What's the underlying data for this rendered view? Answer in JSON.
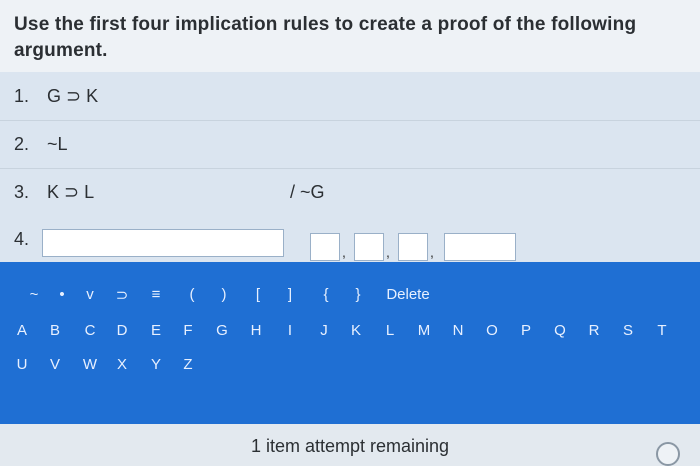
{
  "prompt": "Use the first four implication rules to create a proof of the following argument.",
  "premises": [
    {
      "num": "1.",
      "formula": "G ⊃ K"
    },
    {
      "num": "2.",
      "formula": "~L"
    },
    {
      "num": "3.",
      "formula": "K ⊃ L",
      "conclusion": "/ ~G"
    }
  ],
  "input_line": {
    "num": "4.",
    "formula_value": "",
    "justification_values": [
      "",
      "",
      "",
      ""
    ]
  },
  "keyboard": {
    "symbols": [
      "~",
      "•",
      "v",
      "⊃",
      "≡",
      "(",
      ")",
      "[",
      "]",
      "{",
      "}"
    ],
    "delete_label": "Delete",
    "letters_row1": [
      "A",
      "B",
      "C",
      "D",
      "E",
      "F",
      "G",
      "H",
      "I",
      "J",
      "K",
      "L",
      "M",
      "N",
      "O",
      "P",
      "Q",
      "R",
      "S",
      "T"
    ],
    "letters_row2": [
      "U",
      "V",
      "W",
      "X",
      "Y",
      "Z"
    ]
  },
  "footer": {
    "remaining": "1 item attempt remaining"
  },
  "colors": {
    "keyboard_bg": "#1f6fd3",
    "key_text": "#e7f0ff",
    "page_bg": "#dfe6ee"
  }
}
